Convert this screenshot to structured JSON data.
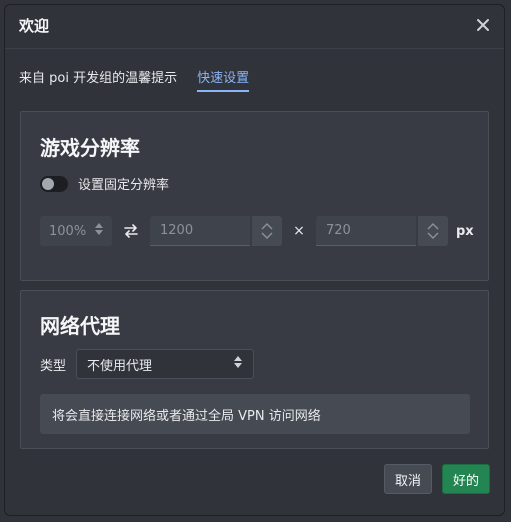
{
  "dialog": {
    "title": "欢迎",
    "close_icon": "close-icon"
  },
  "tabs": [
    {
      "label": "来自 poi 开发组的温馨提示",
      "active": false
    },
    {
      "label": "快速设置",
      "active": true
    }
  ],
  "resolution": {
    "title": "游戏分辨率",
    "fixed_label": "设置固定分辨率",
    "fixed_enabled": false,
    "scale_value": "100%",
    "width_value": "1200",
    "height_value": "720",
    "times_symbol": "×",
    "unit": "px"
  },
  "proxy": {
    "title": "网络代理",
    "type_label": "类型",
    "type_selected": "不使用代理",
    "description": "将会直接连接网络或者通过全局 VPN 访问网络"
  },
  "footer": {
    "cancel_label": "取消",
    "ok_label": "好的"
  },
  "colors": {
    "accent": "#8ab4f8",
    "ok_button": "#238551"
  }
}
